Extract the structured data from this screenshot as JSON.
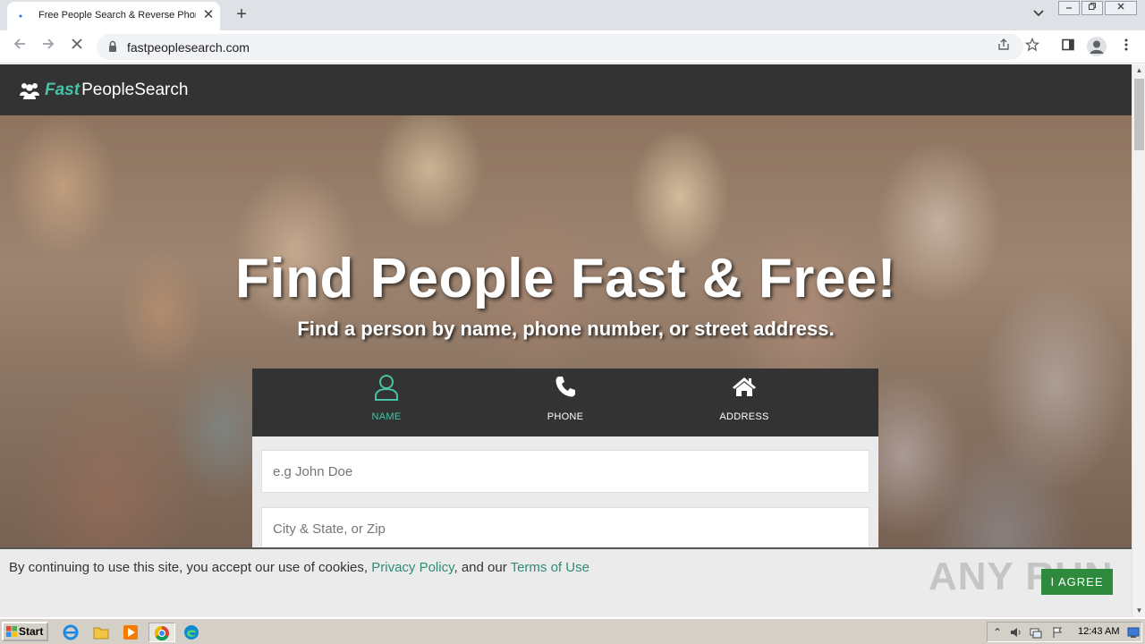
{
  "browser": {
    "tab_title": "Free People Search & Reverse Phone Lookup",
    "tab_close": "✕",
    "new_tab": "+",
    "url": "fastpeoplesearch.com"
  },
  "site": {
    "logo_fast": "Fast",
    "logo_rest": "PeopleSearch",
    "hero_title": "Find People Fast & Free!",
    "hero_subtitle": "Find a person by name, phone number, or street address.",
    "tabs": [
      {
        "label": "NAME",
        "icon": "user-icon",
        "active": true
      },
      {
        "label": "PHONE",
        "icon": "phone-icon",
        "active": false
      },
      {
        "label": "ADDRESS",
        "icon": "home-icon",
        "active": false
      }
    ],
    "name_placeholder": "e.g John Doe",
    "location_placeholder": "City & State, or Zip",
    "accent_color": "#48c2a5"
  },
  "cookie_banner": {
    "text_before": "By continuing to use this site, you accept our use of cookies, ",
    "privacy_link": "Privacy Policy",
    "text_middle": ", and our ",
    "terms_link": "Terms of Use",
    "agree_label": "I AGREE"
  },
  "watermark": "ANY RUN",
  "taskbar": {
    "start_label": "Start",
    "clock": "12:43 AM"
  }
}
